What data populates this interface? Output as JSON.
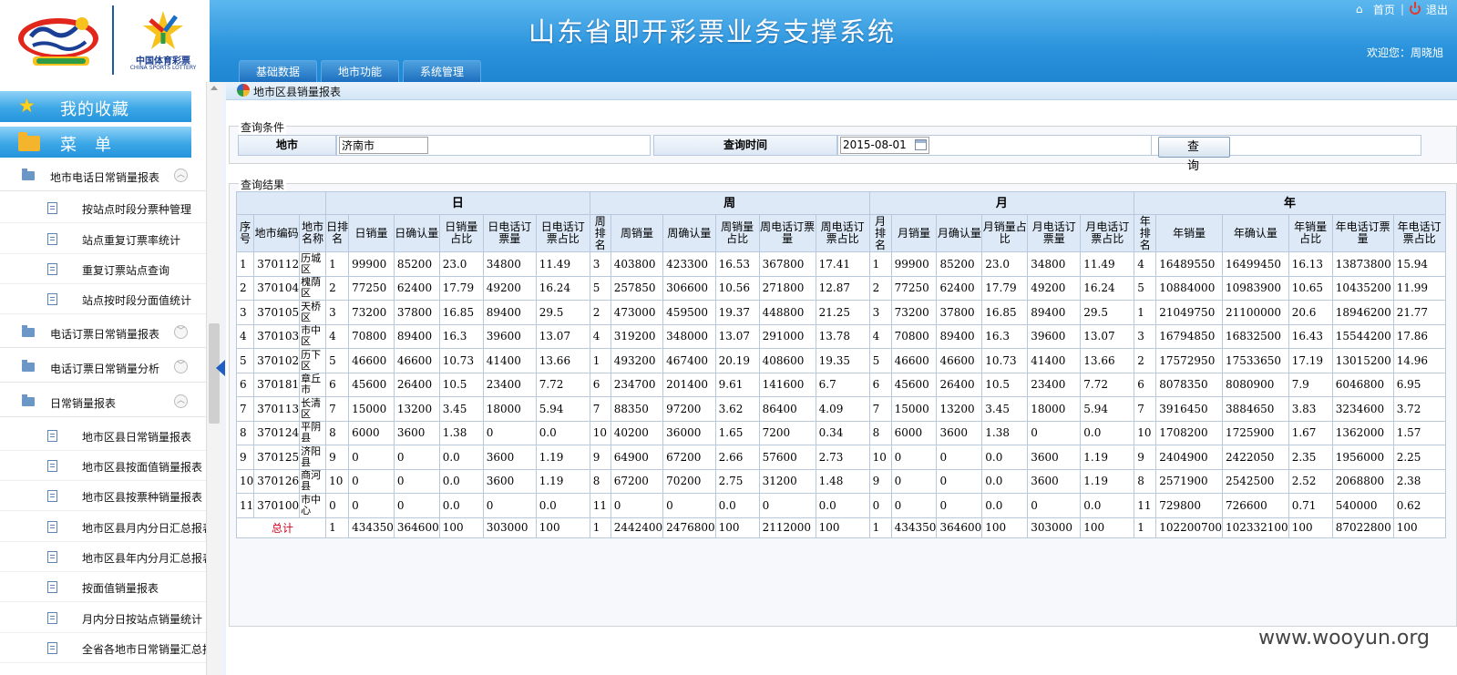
{
  "header": {
    "title": "山东省即开彩票业务支撑系统",
    "home_label": "首页",
    "logout_label": "退出",
    "separator": "|",
    "welcome": "欢迎您：周晓旭",
    "logo2_text": "中国体育彩票",
    "logo2_sub": "CHINA SPORTS LOTTERY",
    "nav_tabs": [
      "基础数据",
      "地市功能",
      "系统管理"
    ]
  },
  "sidebar": {
    "favorites_label": "我的收藏",
    "menu_label": "菜　单",
    "groups": [
      {
        "label": "地市电话日常销量报表",
        "items": [
          "按站点时段分票种管理",
          "站点重复订票率统计",
          "重复订票站点查询",
          "站点按时段分面值统计"
        ]
      },
      {
        "label": "电话订票日常销量报表",
        "items": []
      },
      {
        "label": "电话订票日常销量分析",
        "items": []
      },
      {
        "label": "日常销量报表",
        "items": [
          "地市区县日常销量报表",
          "地市区县按面值销量报表",
          "地市区县按票种销量报表",
          "地市区县月内分日汇总报表",
          "地市区县年内分月汇总报表",
          "按面值销量报表",
          "月内分日按站点销量统计",
          "全省各地市日常销量汇总报"
        ]
      }
    ]
  },
  "page": {
    "title": "地市区县销量报表",
    "query_legend": "查询条件",
    "city_label": "地市",
    "city_value": "济南市",
    "time_label": "查询时间",
    "time_value": "2015-08-01",
    "query_button": "查询",
    "result_legend": "查询结果"
  },
  "table": {
    "groups": [
      "日",
      "周",
      "月",
      "年"
    ],
    "fixed_headers": [
      "序号",
      "地市编码",
      "地市名称"
    ],
    "day_headers": [
      "日排名",
      "日销量",
      "日确认量",
      "日销量占比",
      "日电话订票量",
      "日电话订票占比"
    ],
    "week_headers": [
      "周排名",
      "周销量",
      "周确认量",
      "周销量占比",
      "周电话订票量",
      "周电话订票占比"
    ],
    "month_headers": [
      "月排名",
      "月销量",
      "月确认量",
      "月销量占比",
      "月电话订票量",
      "月电话订票占比"
    ],
    "year_headers": [
      "年排名",
      "年销量",
      "年确认量",
      "年销量占比",
      "年电话订票量",
      "年电话订票占比"
    ],
    "rows": [
      [
        "1",
        "370112",
        "历城区",
        "1",
        "99900",
        "85200",
        "23.0",
        "34800",
        "11.49",
        "3",
        "403800",
        "423300",
        "16.53",
        "367800",
        "17.41",
        "1",
        "99900",
        "85200",
        "23.0",
        "34800",
        "11.49",
        "4",
        "16489550",
        "16499450",
        "16.13",
        "13873800",
        "15.94"
      ],
      [
        "2",
        "370104",
        "槐荫区",
        "2",
        "77250",
        "62400",
        "17.79",
        "49200",
        "16.24",
        "5",
        "257850",
        "306600",
        "10.56",
        "271800",
        "12.87",
        "2",
        "77250",
        "62400",
        "17.79",
        "49200",
        "16.24",
        "5",
        "10884000",
        "10983900",
        "10.65",
        "10435200",
        "11.99"
      ],
      [
        "3",
        "370105",
        "天桥区",
        "3",
        "73200",
        "37800",
        "16.85",
        "89400",
        "29.5",
        "2",
        "473000",
        "459500",
        "19.37",
        "448800",
        "21.25",
        "3",
        "73200",
        "37800",
        "16.85",
        "89400",
        "29.5",
        "1",
        "21049750",
        "21100000",
        "20.6",
        "18946200",
        "21.77"
      ],
      [
        "4",
        "370103",
        "市中区",
        "4",
        "70800",
        "89400",
        "16.3",
        "39600",
        "13.07",
        "4",
        "319200",
        "348000",
        "13.07",
        "291000",
        "13.78",
        "4",
        "70800",
        "89400",
        "16.3",
        "39600",
        "13.07",
        "3",
        "16794850",
        "16832500",
        "16.43",
        "15544200",
        "17.86"
      ],
      [
        "5",
        "370102",
        "历下区",
        "5",
        "46600",
        "46600",
        "10.73",
        "41400",
        "13.66",
        "1",
        "493200",
        "467400",
        "20.19",
        "408600",
        "19.35",
        "5",
        "46600",
        "46600",
        "10.73",
        "41400",
        "13.66",
        "2",
        "17572950",
        "17533650",
        "17.19",
        "13015200",
        "14.96"
      ],
      [
        "6",
        "370181",
        "章丘市",
        "6",
        "45600",
        "26400",
        "10.5",
        "23400",
        "7.72",
        "6",
        "234700",
        "201400",
        "9.61",
        "141600",
        "6.7",
        "6",
        "45600",
        "26400",
        "10.5",
        "23400",
        "7.72",
        "6",
        "8078350",
        "8080900",
        "7.9",
        "6046800",
        "6.95"
      ],
      [
        "7",
        "370113",
        "长清区",
        "7",
        "15000",
        "13200",
        "3.45",
        "18000",
        "5.94",
        "7",
        "88350",
        "97200",
        "3.62",
        "86400",
        "4.09",
        "7",
        "15000",
        "13200",
        "3.45",
        "18000",
        "5.94",
        "7",
        "3916450",
        "3884650",
        "3.83",
        "3234600",
        "3.72"
      ],
      [
        "8",
        "370124",
        "平阴县",
        "8",
        "6000",
        "3600",
        "1.38",
        "0",
        "0.0",
        "10",
        "40200",
        "36000",
        "1.65",
        "7200",
        "0.34",
        "8",
        "6000",
        "3600",
        "1.38",
        "0",
        "0.0",
        "10",
        "1708200",
        "1725900",
        "1.67",
        "1362000",
        "1.57"
      ],
      [
        "9",
        "370125",
        "济阳县",
        "9",
        "0",
        "0",
        "0.0",
        "3600",
        "1.19",
        "9",
        "64900",
        "67200",
        "2.66",
        "57600",
        "2.73",
        "10",
        "0",
        "0",
        "0.0",
        "3600",
        "1.19",
        "9",
        "2404900",
        "2422050",
        "2.35",
        "1956000",
        "2.25"
      ],
      [
        "10",
        "370126",
        "商河县",
        "10",
        "0",
        "0",
        "0.0",
        "3600",
        "1.19",
        "8",
        "67200",
        "70200",
        "2.75",
        "31200",
        "1.48",
        "9",
        "0",
        "0",
        "0.0",
        "3600",
        "1.19",
        "8",
        "2571900",
        "2542500",
        "2.52",
        "2068800",
        "2.38"
      ],
      [
        "11",
        "370100",
        "市中心",
        "0",
        "0",
        "0",
        "0.0",
        "0",
        "0.0",
        "11",
        "0",
        "0",
        "0.0",
        "0",
        "0.0",
        "0",
        "0",
        "0",
        "0.0",
        "0",
        "0.0",
        "11",
        "729800",
        "726600",
        "0.71",
        "540000",
        "0.62"
      ]
    ],
    "total_label": "总计",
    "total": [
      "1",
      "434350",
      "364600",
      "100",
      "303000",
      "100",
      "1",
      "2442400",
      "2476800",
      "100",
      "2112000",
      "100",
      "1",
      "434350",
      "364600",
      "100",
      "303000",
      "100",
      "1",
      "102200700",
      "102332100",
      "100",
      "87022800",
      "100"
    ]
  },
  "watermark": "www.wooyun.org"
}
